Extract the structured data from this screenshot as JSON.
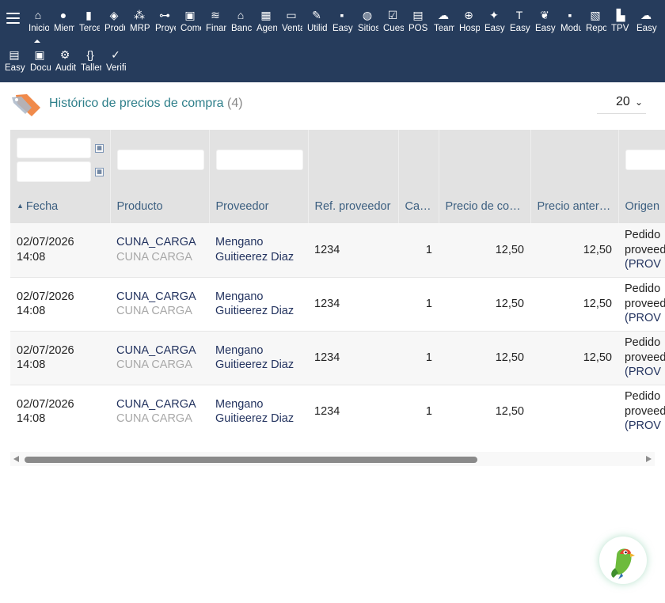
{
  "topbar": {
    "menu_row_1": [
      {
        "label": "Inicio",
        "icon": "home-icon",
        "glyph": "⌂"
      },
      {
        "label": "Miembros",
        "icon": "person-icon",
        "glyph": "●"
      },
      {
        "label": "Terceros",
        "icon": "building-icon",
        "glyph": "▮"
      },
      {
        "label": "Productos",
        "icon": "cube-icon",
        "glyph": "◈"
      },
      {
        "label": "MRP",
        "icon": "cubes-icon",
        "glyph": "⁂"
      },
      {
        "label": "Proyectos",
        "icon": "sitemap-icon",
        "glyph": "⊶"
      },
      {
        "label": "Comercial",
        "icon": "briefcase-icon",
        "glyph": "▣"
      },
      {
        "label": "Financiera",
        "icon": "coins-icon",
        "glyph": "≋"
      },
      {
        "label": "Bancos",
        "icon": "bank-icon",
        "glyph": "⌂"
      },
      {
        "label": "Agenda",
        "icon": "calendar-icon",
        "glyph": "▦"
      },
      {
        "label": "Ventas",
        "icon": "ticket-icon",
        "glyph": "▭"
      },
      {
        "label": "Utilidades",
        "icon": "wrench-icon",
        "glyph": "✎"
      },
      {
        "label": "Easy",
        "icon": "note-icon",
        "glyph": "▪"
      },
      {
        "label": "Sitios",
        "icon": "globe-icon",
        "glyph": "◍"
      },
      {
        "label": "Cuestionarios",
        "icon": "checkbox-icon",
        "glyph": "☑"
      },
      {
        "label": "POS",
        "icon": "register-icon",
        "glyph": "▤"
      },
      {
        "label": "Team",
        "icon": "cloud-icon",
        "glyph": "☁"
      },
      {
        "label": "Hospital",
        "icon": "globe-grid-icon",
        "glyph": "⊕"
      },
      {
        "label": "Easy",
        "icon": "compass-icon",
        "glyph": "✦"
      },
      {
        "label": "Easy",
        "icon": "text-t-icon",
        "glyph": "T"
      },
      {
        "label": "Easy",
        "icon": "parrot-icon",
        "glyph": "❦"
      },
      {
        "label": "Modulos",
        "icon": "page-icon",
        "glyph": "▪"
      },
      {
        "label": "Reportes",
        "icon": "report-icon",
        "glyph": "▧"
      },
      {
        "label": "TPV",
        "icon": "shop-icon",
        "glyph": "▙"
      },
      {
        "label": "Easy",
        "icon": "cloud-server-icon",
        "glyph": "☁"
      }
    ],
    "menu_row_2": [
      {
        "label": "Easy",
        "icon": "document-icon",
        "glyph": "▤"
      },
      {
        "label": "Documentos",
        "icon": "video-icon",
        "glyph": "▣"
      },
      {
        "label": "Auditoria",
        "icon": "audit-icon",
        "glyph": "⚙"
      },
      {
        "label": "Taller",
        "icon": "braces-icon",
        "glyph": "{}"
      },
      {
        "label": "Verificar",
        "icon": "checkmark-icon",
        "glyph": "✓"
      }
    ]
  },
  "header": {
    "title": "Histórico de precios de compra",
    "count": "(4)",
    "page_size": "20"
  },
  "table": {
    "columns": [
      {
        "label": "Fecha",
        "sorted": true
      },
      {
        "label": "Producto"
      },
      {
        "label": "Proveedor"
      },
      {
        "label": "Ref. proveedor"
      },
      {
        "label": "Cant.",
        "numeric": true
      },
      {
        "label": "Precio de compra",
        "numeric": true
      },
      {
        "label": "Precio anterior",
        "numeric": true
      },
      {
        "label": "Origen"
      }
    ],
    "rows": [
      {
        "date": "02/07/2026",
        "time": "14:08",
        "product_ref": "CUNA_CARGA",
        "product_label": "CUNA CARGA",
        "supplier_1": "Mengano",
        "supplier_2": "Guitieerez Diaz",
        "supplier_ref": "1234",
        "qty": "1",
        "price": "12,50",
        "prev_price": "12,50",
        "origin_1": "Pedido",
        "origin_2": "proveedor",
        "origin_3": "(PROV"
      },
      {
        "date": "02/07/2026",
        "time": "14:08",
        "product_ref": "CUNA_CARGA",
        "product_label": "CUNA CARGA",
        "supplier_1": "Mengano",
        "supplier_2": "Guitieerez Diaz",
        "supplier_ref": "1234",
        "qty": "1",
        "price": "12,50",
        "prev_price": "12,50",
        "origin_1": "Pedido",
        "origin_2": "proveedor",
        "origin_3": "(PROV"
      },
      {
        "date": "02/07/2026",
        "time": "14:08",
        "product_ref": "CUNA_CARGA",
        "product_label": "CUNA CARGA",
        "supplier_1": "Mengano",
        "supplier_2": "Guitieerez Diaz",
        "supplier_ref": "1234",
        "qty": "1",
        "price": "12,50",
        "prev_price": "12,50",
        "origin_1": "Pedido",
        "origin_2": "proveedor",
        "origin_3": "(PROV"
      },
      {
        "date": "02/07/2026",
        "time": "14:08",
        "product_ref": "CUNA_CARGA",
        "product_label": "CUNA CARGA",
        "supplier_1": "Mengano",
        "supplier_2": "Guitieerez Diaz",
        "supplier_ref": "1234",
        "qty": "1",
        "price": "12,50",
        "prev_price": "",
        "origin_1": "Pedido",
        "origin_2": "proveedor",
        "origin_3": "(PROV"
      }
    ]
  },
  "colors": {
    "topbar": "#263c5c",
    "title": "#2e7f8a",
    "link": "#23335f",
    "header_text": "#3c5f80",
    "tag_orange": "#f08a4b"
  }
}
